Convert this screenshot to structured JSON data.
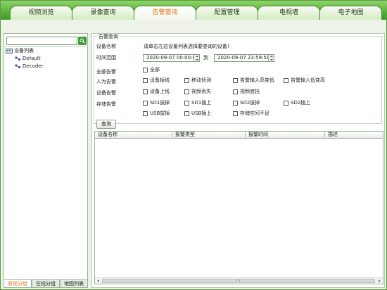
{
  "tabs": [
    {
      "label": "视频浏览"
    },
    {
      "label": "录像查询"
    },
    {
      "label": "告警查询"
    },
    {
      "label": "配置管理"
    },
    {
      "label": "电视墙"
    },
    {
      "label": "电子地图"
    }
  ],
  "active_tab": "告警查询",
  "left_panel": {
    "search": {
      "value": "",
      "placeholder": ""
    },
    "tree": {
      "root": "设备列表",
      "children": [
        "Default",
        "Decoder"
      ]
    },
    "bottom_tabs": [
      "原始分组",
      "在线分组",
      "地图列表"
    ],
    "active_bottom_tab": "原始分组"
  },
  "alarm_query": {
    "group_title": "告警查询",
    "device_name_label": "设备名称",
    "device_name_hint": "请单击左边设备列表选择要查询的设备!",
    "time_range_label": "时间范围",
    "start_time": "2020-09-07   00:00:00",
    "to_label": "到",
    "end_time": "2020-09-07   23:59:59",
    "rows": [
      {
        "label": "全部告警",
        "options": [
          "全部"
        ]
      },
      {
        "label": "人为告警",
        "options": [
          "设备掉线",
          "移动侦测",
          "告警输入高变低",
          "告警输入低变高"
        ]
      },
      {
        "label": "设备告警",
        "options": [
          "设备上线",
          "视频丢失",
          "视频遮挡"
        ]
      },
      {
        "label": "存储告警",
        "options": [
          "SD1拔掉",
          "SD1插上",
          "SD2拔掉",
          "SD2插上"
        ]
      },
      {
        "label": "",
        "options": [
          "USB拔掉",
          "USB插上",
          "存储空间不足"
        ]
      }
    ],
    "query_button": "查询"
  },
  "results_table": {
    "columns": [
      "设备名称",
      "报警类型",
      "报警时间",
      "描述"
    ],
    "rows": []
  },
  "colors": {
    "accent": "#e8721c",
    "tab_bar": "#58b03a",
    "border": "#5c9a3c"
  }
}
